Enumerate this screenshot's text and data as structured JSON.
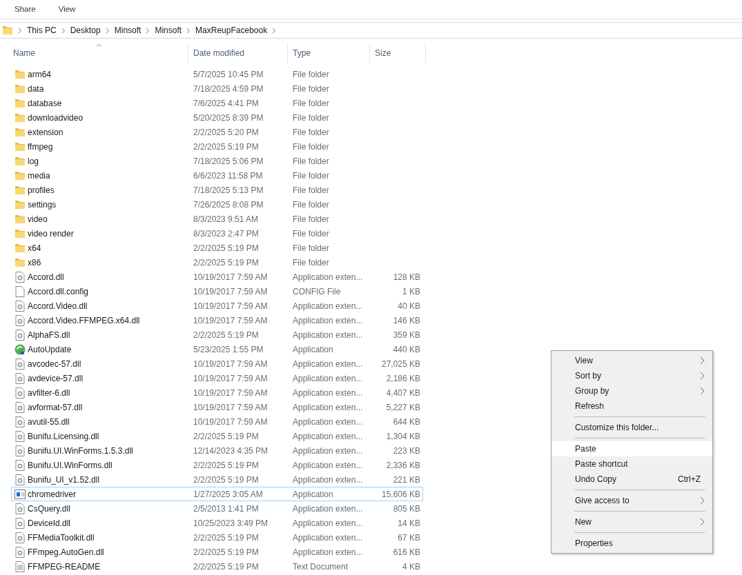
{
  "ribbon": {
    "tabs": [
      "Share",
      "View"
    ]
  },
  "address_bar": {
    "path": [
      "This PC",
      "Desktop",
      "Minsoft",
      "Minsoft",
      "MaxReupFacebook"
    ]
  },
  "file_list": {
    "columns": [
      "Name",
      "Date modified",
      "Type",
      "Size"
    ],
    "rows": [
      {
        "kind": "folder",
        "name": "arm64",
        "date": "5/7/2025 10:45 PM",
        "type": "File folder",
        "size": "",
        "selected": false
      },
      {
        "kind": "folder",
        "name": "data",
        "date": "7/18/2025 4:59 PM",
        "type": "File folder",
        "size": "",
        "selected": false
      },
      {
        "kind": "folder",
        "name": "database",
        "date": "7/6/2025 4:41 PM",
        "type": "File folder",
        "size": "",
        "selected": false
      },
      {
        "kind": "folder",
        "name": "downloadvideo",
        "date": "5/20/2025 8:39 PM",
        "type": "File folder",
        "size": "",
        "selected": false
      },
      {
        "kind": "folder",
        "name": "extension",
        "date": "2/2/2025 5:20 PM",
        "type": "File folder",
        "size": "",
        "selected": false
      },
      {
        "kind": "folder",
        "name": "ffmpeg",
        "date": "2/2/2025 5:19 PM",
        "type": "File folder",
        "size": "",
        "selected": false
      },
      {
        "kind": "folder",
        "name": "log",
        "date": "7/18/2025 5:06 PM",
        "type": "File folder",
        "size": "",
        "selected": false
      },
      {
        "kind": "folder",
        "name": "media",
        "date": "6/6/2023 11:58 PM",
        "type": "File folder",
        "size": "",
        "selected": false
      },
      {
        "kind": "folder",
        "name": "profiles",
        "date": "7/18/2025 5:13 PM",
        "type": "File folder",
        "size": "",
        "selected": false
      },
      {
        "kind": "folder",
        "name": "settings",
        "date": "7/26/2025 8:08 PM",
        "type": "File folder",
        "size": "",
        "selected": false
      },
      {
        "kind": "folder",
        "name": "video",
        "date": "8/3/2023 9:51 AM",
        "type": "File folder",
        "size": "",
        "selected": false
      },
      {
        "kind": "folder",
        "name": "video render",
        "date": "8/3/2023 2:47 PM",
        "type": "File folder",
        "size": "",
        "selected": false
      },
      {
        "kind": "folder",
        "name": "x64",
        "date": "2/2/2025 5:19 PM",
        "type": "File folder",
        "size": "",
        "selected": false
      },
      {
        "kind": "folder",
        "name": "x86",
        "date": "2/2/2025 5:19 PM",
        "type": "File folder",
        "size": "",
        "selected": false
      },
      {
        "kind": "dll",
        "name": "Accord.dll",
        "date": "10/19/2017 7:59 AM",
        "type": "Application exten...",
        "size": "128 KB",
        "selected": false
      },
      {
        "kind": "config",
        "name": "Accord.dll.config",
        "date": "10/19/2017 7:59 AM",
        "type": "CONFIG File",
        "size": "1 KB",
        "selected": false
      },
      {
        "kind": "dll",
        "name": "Accord.Video.dll",
        "date": "10/19/2017 7:59 AM",
        "type": "Application exten...",
        "size": "40 KB",
        "selected": false
      },
      {
        "kind": "dll",
        "name": "Accord.Video.FFMPEG.x64.dll",
        "date": "10/19/2017 7:59 AM",
        "type": "Application exten...",
        "size": "146 KB",
        "selected": false
      },
      {
        "kind": "dll",
        "name": "AlphaFS.dll",
        "date": "2/2/2025 5:19 PM",
        "type": "Application exten...",
        "size": "359 KB",
        "selected": false
      },
      {
        "kind": "updater",
        "name": "AutoUpdate",
        "date": "5/23/2025 1:55 PM",
        "type": "Application",
        "size": "440 KB",
        "selected": false
      },
      {
        "kind": "dll",
        "name": "avcodec-57.dll",
        "date": "10/19/2017 7:59 AM",
        "type": "Application exten...",
        "size": "27,025 KB",
        "selected": false
      },
      {
        "kind": "dll",
        "name": "avdevice-57.dll",
        "date": "10/19/2017 7:59 AM",
        "type": "Application exten...",
        "size": "2,186 KB",
        "selected": false
      },
      {
        "kind": "dll",
        "name": "avfilter-6.dll",
        "date": "10/19/2017 7:59 AM",
        "type": "Application exten...",
        "size": "4,407 KB",
        "selected": false
      },
      {
        "kind": "dll",
        "name": "avformat-57.dll",
        "date": "10/19/2017 7:59 AM",
        "type": "Application exten...",
        "size": "5,227 KB",
        "selected": false
      },
      {
        "kind": "dll",
        "name": "avutil-55.dll",
        "date": "10/19/2017 7:59 AM",
        "type": "Application exten...",
        "size": "644 KB",
        "selected": false
      },
      {
        "kind": "dll",
        "name": "Bunifu.Licensing.dll",
        "date": "2/2/2025 5:19 PM",
        "type": "Application exten...",
        "size": "1,304 KB",
        "selected": false
      },
      {
        "kind": "dll",
        "name": "Bunifu.UI.WinForms.1.5.3.dll",
        "date": "12/14/2023 4:35 PM",
        "type": "Application exten...",
        "size": "223 KB",
        "selected": false
      },
      {
        "kind": "dll",
        "name": "Bunifu.UI.WinForms.dll",
        "date": "2/2/2025 5:19 PM",
        "type": "Application exten...",
        "size": "2,336 KB",
        "selected": false
      },
      {
        "kind": "dll",
        "name": "Bunifu_UI_v1.52.dll",
        "date": "2/2/2025 5:19 PM",
        "type": "Application exten...",
        "size": "221 KB",
        "selected": false
      },
      {
        "kind": "app",
        "name": "chromedriver",
        "date": "1/27/2025 3:05 AM",
        "type": "Application",
        "size": "15,606 KB",
        "selected": true
      },
      {
        "kind": "dll",
        "name": "CsQuery.dll",
        "date": "2/5/2013 1:41 PM",
        "type": "Application exten...",
        "size": "805 KB",
        "selected": false
      },
      {
        "kind": "dll",
        "name": "DeviceId.dll",
        "date": "10/25/2023 3:49 PM",
        "type": "Application exten...",
        "size": "14 KB",
        "selected": false
      },
      {
        "kind": "dll",
        "name": "FFMediaToolkit.dll",
        "date": "2/2/2025 5:19 PM",
        "type": "Application exten...",
        "size": "67 KB",
        "selected": false
      },
      {
        "kind": "dll",
        "name": "FFmpeg.AutoGen.dll",
        "date": "2/2/2025 5:19 PM",
        "type": "Application exten...",
        "size": "616 KB",
        "selected": false
      },
      {
        "kind": "text",
        "name": "FFMPEG-README",
        "date": "2/2/2025 5:19 PM",
        "type": "Text Document",
        "size": "4 KB",
        "selected": false
      }
    ]
  },
  "context_menu": {
    "groups": [
      [
        {
          "label": "View",
          "submenu": true,
          "selected": false
        },
        {
          "label": "Sort by",
          "submenu": true,
          "selected": false
        },
        {
          "label": "Group by",
          "submenu": true,
          "selected": false
        },
        {
          "label": "Refresh",
          "submenu": false,
          "selected": false
        }
      ],
      [
        {
          "label": "Customize this folder...",
          "submenu": false,
          "selected": false
        }
      ],
      [
        {
          "label": "Paste",
          "submenu": false,
          "selected": true
        },
        {
          "label": "Paste shortcut",
          "submenu": false,
          "selected": false
        },
        {
          "label": "Undo Copy",
          "shortcut": "Ctrl+Z",
          "submenu": false,
          "selected": false
        }
      ],
      [
        {
          "label": "Give access to",
          "submenu": true,
          "selected": false
        }
      ],
      [
        {
          "label": "New",
          "submenu": true,
          "selected": false
        }
      ],
      [
        {
          "label": "Properties",
          "submenu": false,
          "selected": false
        }
      ]
    ]
  }
}
